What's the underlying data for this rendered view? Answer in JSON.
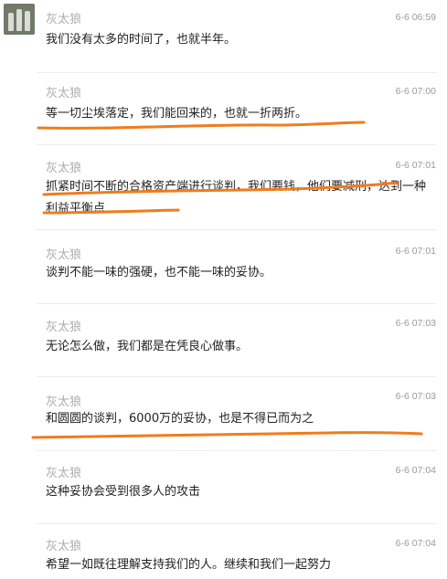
{
  "messages": [
    {
      "name": "灰太狼",
      "time": "6-6 06:59",
      "text": "我们没有太多的时间了，也就半年。"
    },
    {
      "name": "灰太狼",
      "time": "6-6 07:00",
      "text": "等一切尘埃落定，我们能回来的，也就一折两折。"
    },
    {
      "name": "灰太狼",
      "time": "6-6 07:01",
      "text": "抓紧时间不断的合格资产端进行谈判，我们要钱，他们要减刑，达到一种利益平衡点"
    },
    {
      "name": "灰太狼",
      "time": "6-6 07:01",
      "text": "谈判不能一味的强硬，也不能一味的妥协。"
    },
    {
      "name": "灰太狼",
      "time": "6-6 07:03",
      "text": "无论怎么做，我们都是在凭良心做事。"
    },
    {
      "name": "灰太狼",
      "time": "6-6 07:03",
      "text": "和圆圆的谈判，6000万的妥协，也是不得已而为之"
    },
    {
      "name": "灰太狼",
      "time": "6-6 07:04",
      "text": "这种妥协会受到很多人的攻击"
    },
    {
      "name": "灰太狼",
      "time": "6-6 07:04",
      "text": "希望一如既往理解支持我们的人。继续和我们一起努力"
    }
  ],
  "colors": {
    "underline": "#f07c1c",
    "name": "#adadad",
    "time": "#9a9a9a",
    "text": "#222222"
  }
}
